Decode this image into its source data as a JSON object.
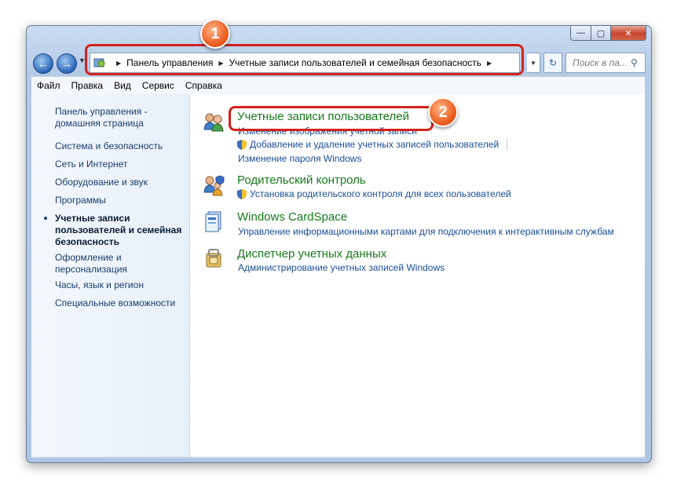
{
  "window": {
    "controls": {
      "minimize": "—",
      "maximize": "▢",
      "close": "✕"
    }
  },
  "toolbar": {
    "back_icon": "arrow-left-icon",
    "forward_icon": "arrow-right-icon",
    "breadcrumbs": [
      "Панель управления",
      "Учетные записи пользователей и семейная безопасность"
    ],
    "search_placeholder": "Поиск в па..."
  },
  "callouts": {
    "first": "1",
    "second": "2"
  },
  "menu": [
    "Файл",
    "Правка",
    "Вид",
    "Сервис",
    "Справка"
  ],
  "sidebar": {
    "items": [
      {
        "label": "Панель управления -\nдомашняя страница"
      },
      {
        "label": "Система и безопасность"
      },
      {
        "label": "Сеть и Интернет"
      },
      {
        "label": "Оборудование и звук"
      },
      {
        "label": "Программы"
      },
      {
        "label": "Учетные записи\nпользователей и семейная\nбезопасность",
        "active": true
      },
      {
        "label": "Оформление и\nперсонализация"
      },
      {
        "label": "Часы, язык и регион"
      },
      {
        "label": "Специальные возможности"
      }
    ]
  },
  "categories": [
    {
      "title": "Учетные записи пользователей",
      "icon": "users-icon",
      "links": [
        {
          "label": "Изменение изображения учетной записи",
          "shield": false
        },
        {
          "label": "Добавление и удаление учетных записей пользователей",
          "shield": true
        },
        {
          "label": "Изменение пароля Windows",
          "shield": false
        }
      ]
    },
    {
      "title": "Родительский контроль",
      "icon": "parental-control-icon",
      "links": [
        {
          "label": "Установка родительского контроля для всех пользователей",
          "shield": true
        }
      ]
    },
    {
      "title": "Windows CardSpace",
      "icon": "cardspace-icon",
      "links": [
        {
          "label": "Управление информационными картами для подключения к интерактивным службам",
          "shield": false
        }
      ]
    },
    {
      "title": "Диспетчер учетных данных",
      "icon": "credential-manager-icon",
      "links": [
        {
          "label": "Администрирование учетных записей Windows",
          "shield": false
        }
      ]
    }
  ],
  "colors": {
    "link": "#1b4d96",
    "category_title": "#177a1c",
    "callout": "#d4221c",
    "badge": "#ea5a1c"
  }
}
